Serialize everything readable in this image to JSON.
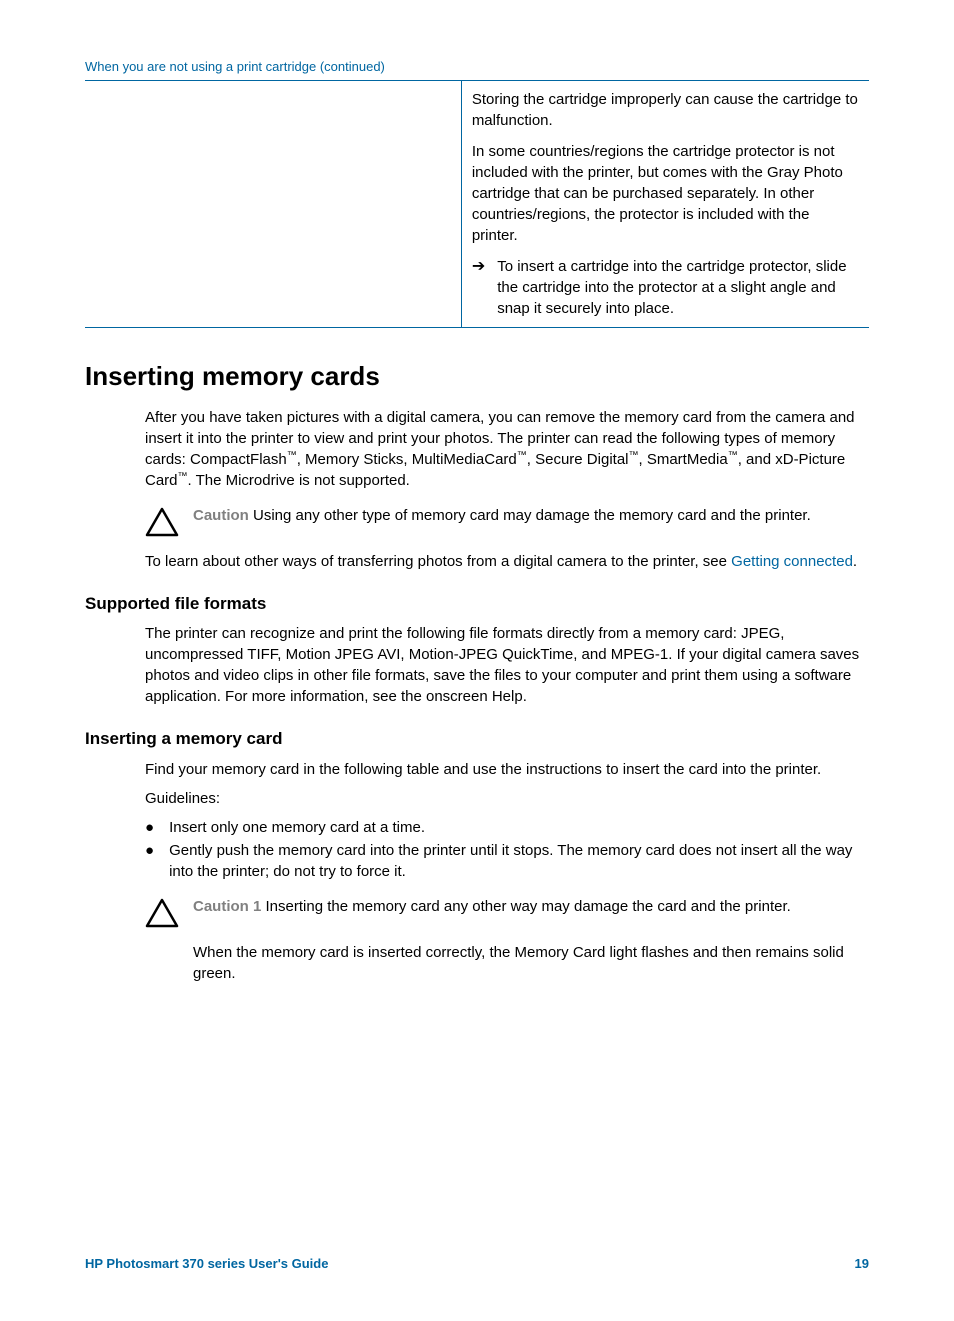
{
  "table": {
    "caption": "When you are not using a print cartridge (continued)",
    "para1": "Storing the cartridge improperly can cause the cartridge to malfunction.",
    "para2": "In some countries/regions the cartridge protector is not included with the printer, but comes with the Gray Photo cartridge that can be purchased separately. In other countries/regions, the protector is included with the printer.",
    "arrow_text": "To insert a cartridge into the cartridge protector, slide the cartridge into the protector at a slight angle and snap it securely into place."
  },
  "heading1": "Inserting memory cards",
  "para_intro_1": "After you have taken pictures with a digital camera, you can remove the memory card from the camera and insert it into the printer to view and print your photos. The printer can read the following types of memory cards: CompactFlash",
  "para_intro_2": ", Memory Sticks, MultiMediaCard",
  "para_intro_3": ", Secure Digital",
  "para_intro_4": ", SmartMedia",
  "para_intro_5": ", and xD-Picture Card",
  "para_intro_6": ". The Microdrive is not supported.",
  "tm": "™",
  "caution1_label": "Caution",
  "caution1_text": " Using any other type of memory card may damage the memory card and the printer.",
  "para_learn_1": "To learn about other ways of transferring photos from a digital camera to the printer, see ",
  "para_learn_link": "Getting connected",
  "para_learn_2": ".",
  "heading2": "Supported file formats",
  "para_formats": "The printer can recognize and print the following file formats directly from a memory card: JPEG, uncompressed TIFF, Motion JPEG AVI, Motion-JPEG QuickTime, and MPEG-1. If your digital camera saves photos and video clips   in other file formats, save the files to your computer and print them using a software application. For more information, see the onscreen Help.",
  "heading3": "Inserting a memory card",
  "para_find": "Find your memory card in the following table and use the instructions to insert the card into the printer.",
  "guidelines_label": "Guidelines:",
  "bullet1": "Insert only one memory card at a time.",
  "bullet2": "Gently push the memory card into the printer until it stops. The memory card does not insert all the way into the printer; do not try to force it.",
  "caution2_label": "Caution 1",
  "caution2_text": " Inserting the memory card any other way may damage the card and the printer.",
  "caution2_sub": "When the memory card is inserted correctly, the Memory Card light flashes and then remains solid green.",
  "footer_left": "HP Photosmart 370 series User's Guide",
  "footer_right": "19"
}
